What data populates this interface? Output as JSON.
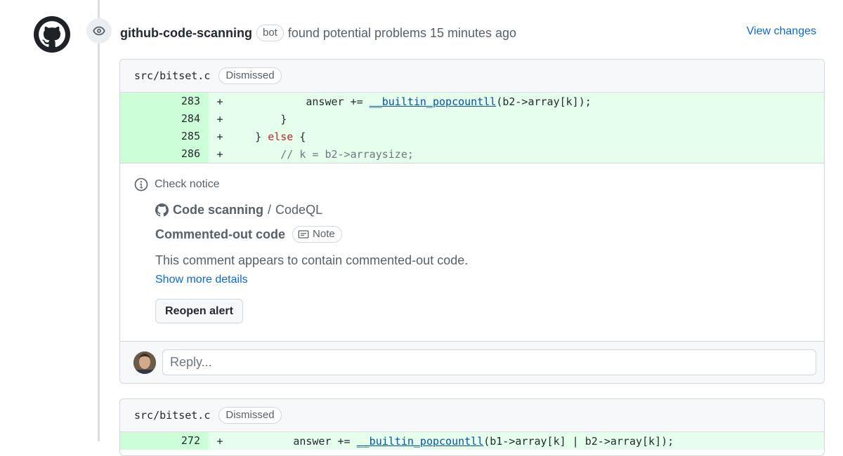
{
  "header": {
    "author": "github-code-scanning",
    "author_badge": "bot",
    "action_text": "found potential problems 15 minutes ago",
    "view_changes": "View changes"
  },
  "alerts": [
    {
      "file": "src/bitset.c",
      "status": "Dismissed",
      "diff": [
        {
          "num": "283",
          "sign": "+",
          "indent": "            ",
          "parts": [
            {
              "t": "answer += ",
              "c": ""
            },
            {
              "t": "__builtin_popcountll",
              "c": "fn"
            },
            {
              "t": "(b2->array[k]);",
              "c": ""
            }
          ]
        },
        {
          "num": "284",
          "sign": "+",
          "indent": "        ",
          "parts": [
            {
              "t": "}",
              "c": ""
            }
          ]
        },
        {
          "num": "285",
          "sign": "+",
          "indent": "    ",
          "parts": [
            {
              "t": "} ",
              "c": ""
            },
            {
              "t": "else",
              "c": "kw"
            },
            {
              "t": " {",
              "c": ""
            }
          ]
        },
        {
          "num": "286",
          "sign": "+",
          "indent": "        ",
          "parts": [
            {
              "t": "// k = b2->arraysize;",
              "c": "cm"
            }
          ]
        }
      ],
      "check": {
        "label": "Check notice",
        "tool": "Code scanning",
        "tool_separator": "/",
        "tool_name": "CodeQL",
        "rule": "Commented-out code",
        "severity": "Note",
        "message": "This comment appears to contain commented-out code.",
        "details_link": "Show more details",
        "action_button": "Reopen alert"
      },
      "reply_placeholder": "Reply..."
    },
    {
      "file": "src/bitset.c",
      "status": "Dismissed",
      "diff": [
        {
          "num": "272",
          "sign": "+",
          "indent": "          ",
          "parts": [
            {
              "t": "answer += ",
              "c": ""
            },
            {
              "t": "__builtin_popcountll",
              "c": "fn"
            },
            {
              "t": "(b1->array[k] | b2->array[k]);",
              "c": ""
            }
          ]
        }
      ]
    }
  ],
  "icons": {
    "author_avatar": "github-octocat-icon",
    "event": "eye-icon",
    "notice": "info-icon",
    "tool": "github-mark-icon",
    "severity": "note-icon"
  },
  "colors": {
    "link": "#0969da",
    "added_line_bg": "#e6ffec",
    "added_num_bg": "#ccffd8",
    "keyword": "#cf222e",
    "function": "#0550ae",
    "comment": "#6e7781"
  }
}
